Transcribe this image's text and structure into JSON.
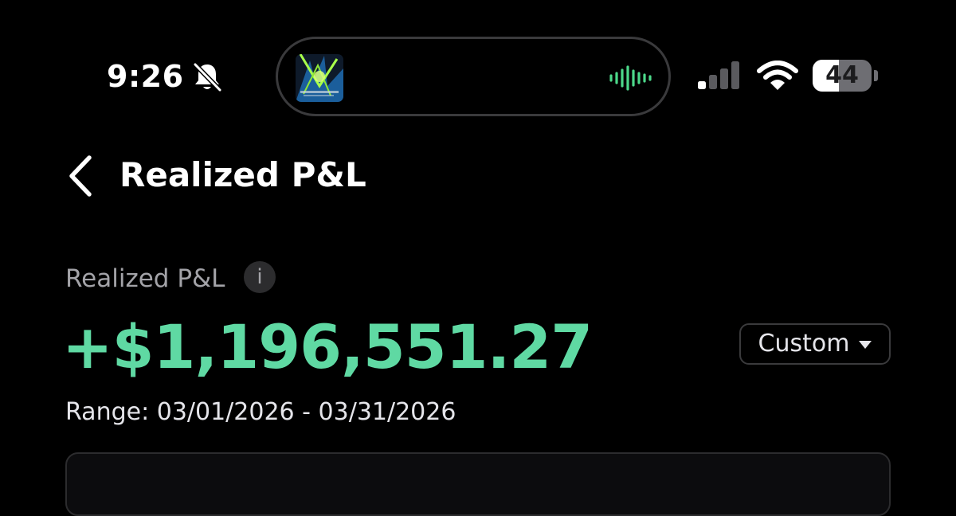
{
  "status_bar": {
    "time": "9:26",
    "silent_icon": "bell-slash-icon",
    "signal_icon": "cellular-signal-icon",
    "signal_bars_active": 1,
    "signal_bars_total": 4,
    "wifi_icon": "wifi-icon",
    "battery_percent": "44",
    "battery_level": 0.44
  },
  "dynamic_island": {
    "album_art_icon": "album-art-thumbnail",
    "waveform_icon": "audio-waveform-icon",
    "waveform_color": "#4cd98a"
  },
  "header": {
    "back_icon": "chevron-left-icon",
    "title": "Realized P&L"
  },
  "summary": {
    "label": "Realized P&L",
    "info_icon": "info-icon",
    "info_glyph": "i",
    "value": "+$1,196,551.27",
    "value_color": "#5fd9a3",
    "range_selector": "Custom",
    "range_text": "Range: 03/01/2026 - 03/31/2026"
  },
  "colors": {
    "background": "#000000",
    "positive": "#5fd9a3",
    "secondary_text": "#a3a3a8"
  }
}
